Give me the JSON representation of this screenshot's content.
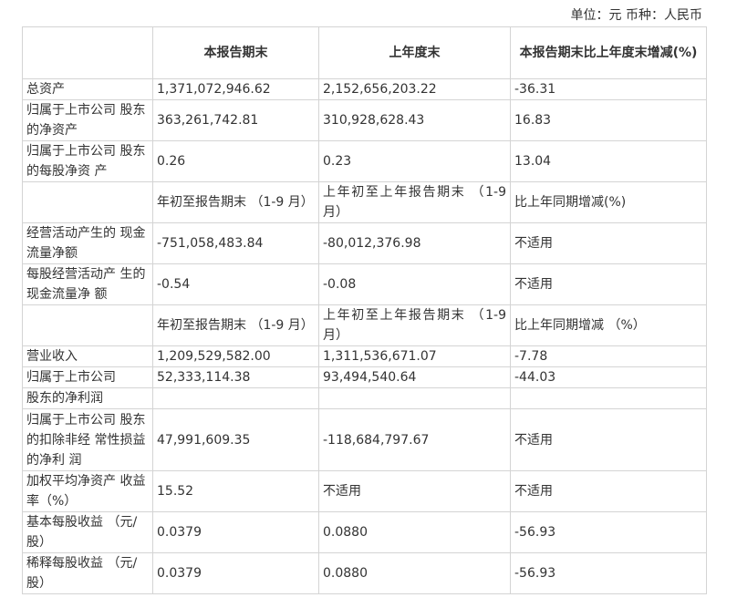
{
  "unit_note": "单位：元 币种：人民币",
  "header": {
    "col0": "",
    "col1": "本报告期末",
    "col2": "上年度末",
    "col3": "本报告期末比上年度末增减(%)"
  },
  "rows": [
    {
      "label": "总资产",
      "c1": "1,371,072,946.62",
      "c2": "2,152,656,203.22",
      "c3": "-36.31"
    },
    {
      "label": "归属于上市公司 股东的净资产",
      "c1": "363,261,742.81",
      "c2": "310,928,628.43",
      "c3": "16.83"
    },
    {
      "label": "归属于上市公司 股东的每股净资 产",
      "c1": "0.26",
      "c2": "0.23",
      "c3": "13.04"
    },
    {
      "label": "",
      "c1": "年初至报告期末 （1-9 月）",
      "c2": "上年初至上年报告期末 （1-9月）",
      "c3": "比上年同期增减(%)"
    },
    {
      "label": "经营活动产生的 现金流量净额",
      "c1": "-751,058,483.84",
      "c2": "-80,012,376.98",
      "c3": "不适用"
    },
    {
      "label": "每股经营活动产 生的现金流量净 额",
      "c1": "-0.54",
      "c2": "-0.08",
      "c3": "不适用"
    },
    {
      "label": "",
      "c1": "年初至报告期末 （1-9 月）",
      "c2": "上年初至上年报告期末 （1-9月）",
      "c3": "比上年同期增减 （%）"
    },
    {
      "label": "营业收入",
      "c1": "1,209,529,582.00",
      "c2": "1,311,536,671.07",
      "c3": "-7.78"
    },
    {
      "label": "归属于上市公司",
      "c1": "52,333,114.38",
      "c2": "93,494,540.64",
      "c3": "-44.03"
    },
    {
      "label": "股东的净利润",
      "c1": "",
      "c2": "",
      "c3": ""
    },
    {
      "label": "归属于上市公司 股东的扣除非经 常性损益的净利 润",
      "c1": "47,991,609.35",
      "c2": "-118,684,797.67",
      "c3": "不适用"
    },
    {
      "label": "加权平均净资产 收益率（%）",
      "c1": "15.52",
      "c2": "不适用",
      "c3": "不适用"
    },
    {
      "label": "基本每股收益 （元/股）",
      "c1": "0.0379",
      "c2": "0.0880",
      "c3": "-56.93"
    },
    {
      "label": "稀释每股收益 （元/股）",
      "c1": "0.0379",
      "c2": "0.0880",
      "c3": "-56.93"
    }
  ]
}
